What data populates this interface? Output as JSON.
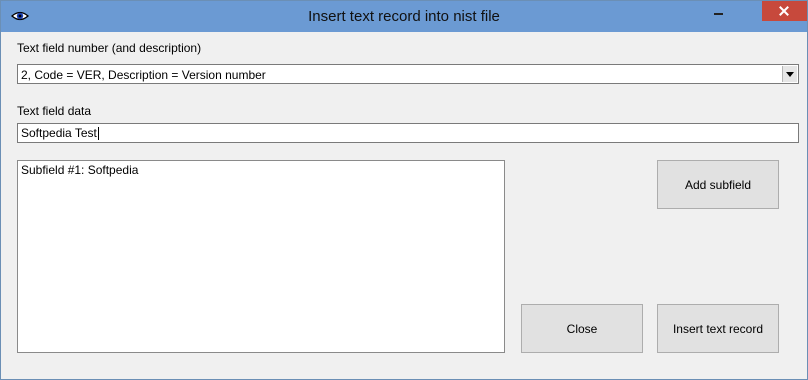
{
  "window": {
    "title": "Insert text record into nist file",
    "app_icon": "eye-icon"
  },
  "form": {
    "field_number_label": "Text field number (and description)",
    "field_number_selected": "2, Code = VER, Description = Version number",
    "field_data_label": "Text field data",
    "field_data_value": "Softpedia Test",
    "subfields": [
      "Subfield #1: Softpedia"
    ]
  },
  "buttons": {
    "add_subfield": "Add subfield",
    "close": "Close",
    "insert": "Insert text record"
  },
  "colors": {
    "titlebar": "#6b9ad3",
    "close_button": "#c7493c",
    "background": "#f0f0f0"
  }
}
